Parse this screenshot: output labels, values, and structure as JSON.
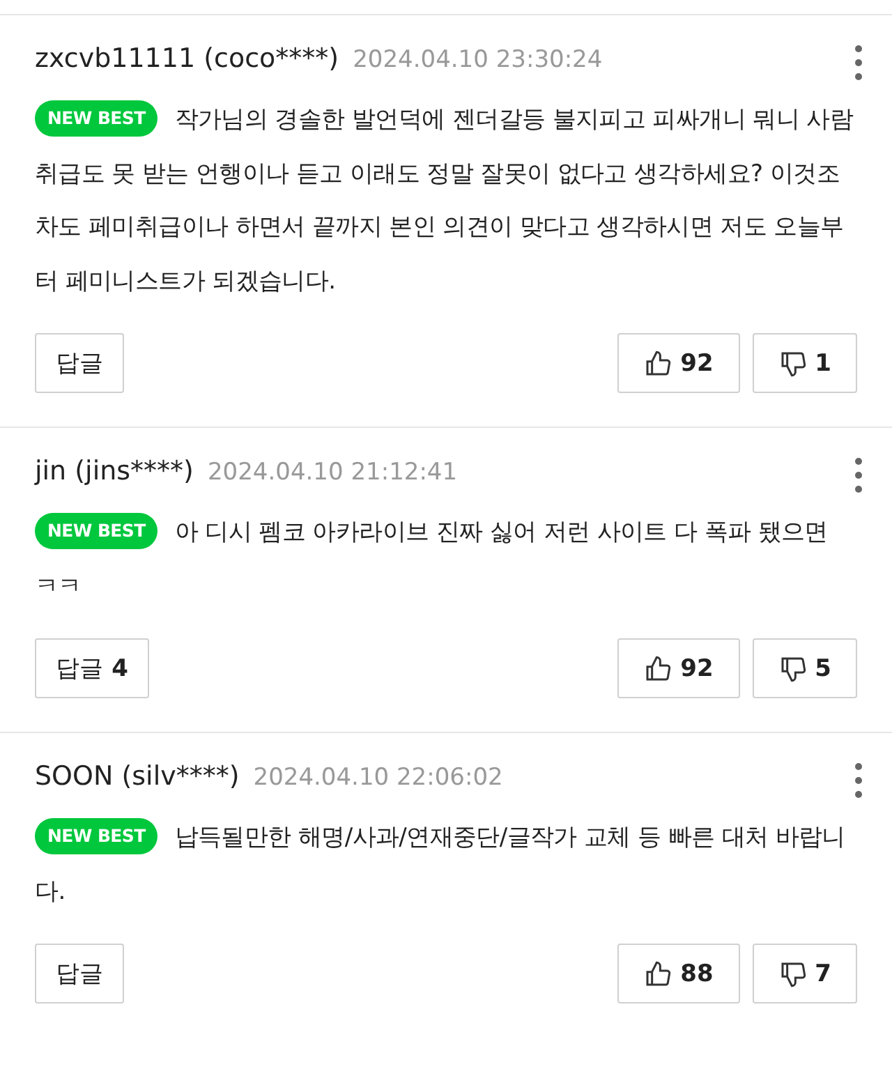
{
  "comments": [
    {
      "author": "zxcvb11111 (coco****)",
      "date": "2024.04.10 23:30:24",
      "badge": "NEW BEST",
      "text": "작가님의 경솔한 발언덕에 젠더갈등 불지피고 피싸개니 뭐니 사람 취급도 못 받는 언행이나 듣고 이래도 정말 잘못이 없다고 생각하세요? 이것조차도 페미취급이나 하면서 끝까지 본인 의견이 맞다고 생각하시면 저도 오늘부터 페미니스트가 되겠습니다.",
      "reply_label": "답글",
      "likes": "92",
      "dislikes": "1"
    },
    {
      "author": "jin (jins****)",
      "date": "2024.04.10 21:12:41",
      "badge": "NEW BEST",
      "text": "아 디시 펨코 아카라이브 진짜 싫어 저런 사이트 다 폭파 됐으면 ㅋㅋ",
      "reply_label": "답글",
      "reply_count": "4",
      "likes": "92",
      "dislikes": "5"
    },
    {
      "author": "SOON (silv****)",
      "date": "2024.04.10 22:06:02",
      "badge": "NEW BEST",
      "text": "납득될만한 해명/사과/연재중단/글작가 교체 등 빠른 대처 바랍니다.",
      "reply_label": "답글",
      "likes": "88",
      "dislikes": "7"
    }
  ]
}
